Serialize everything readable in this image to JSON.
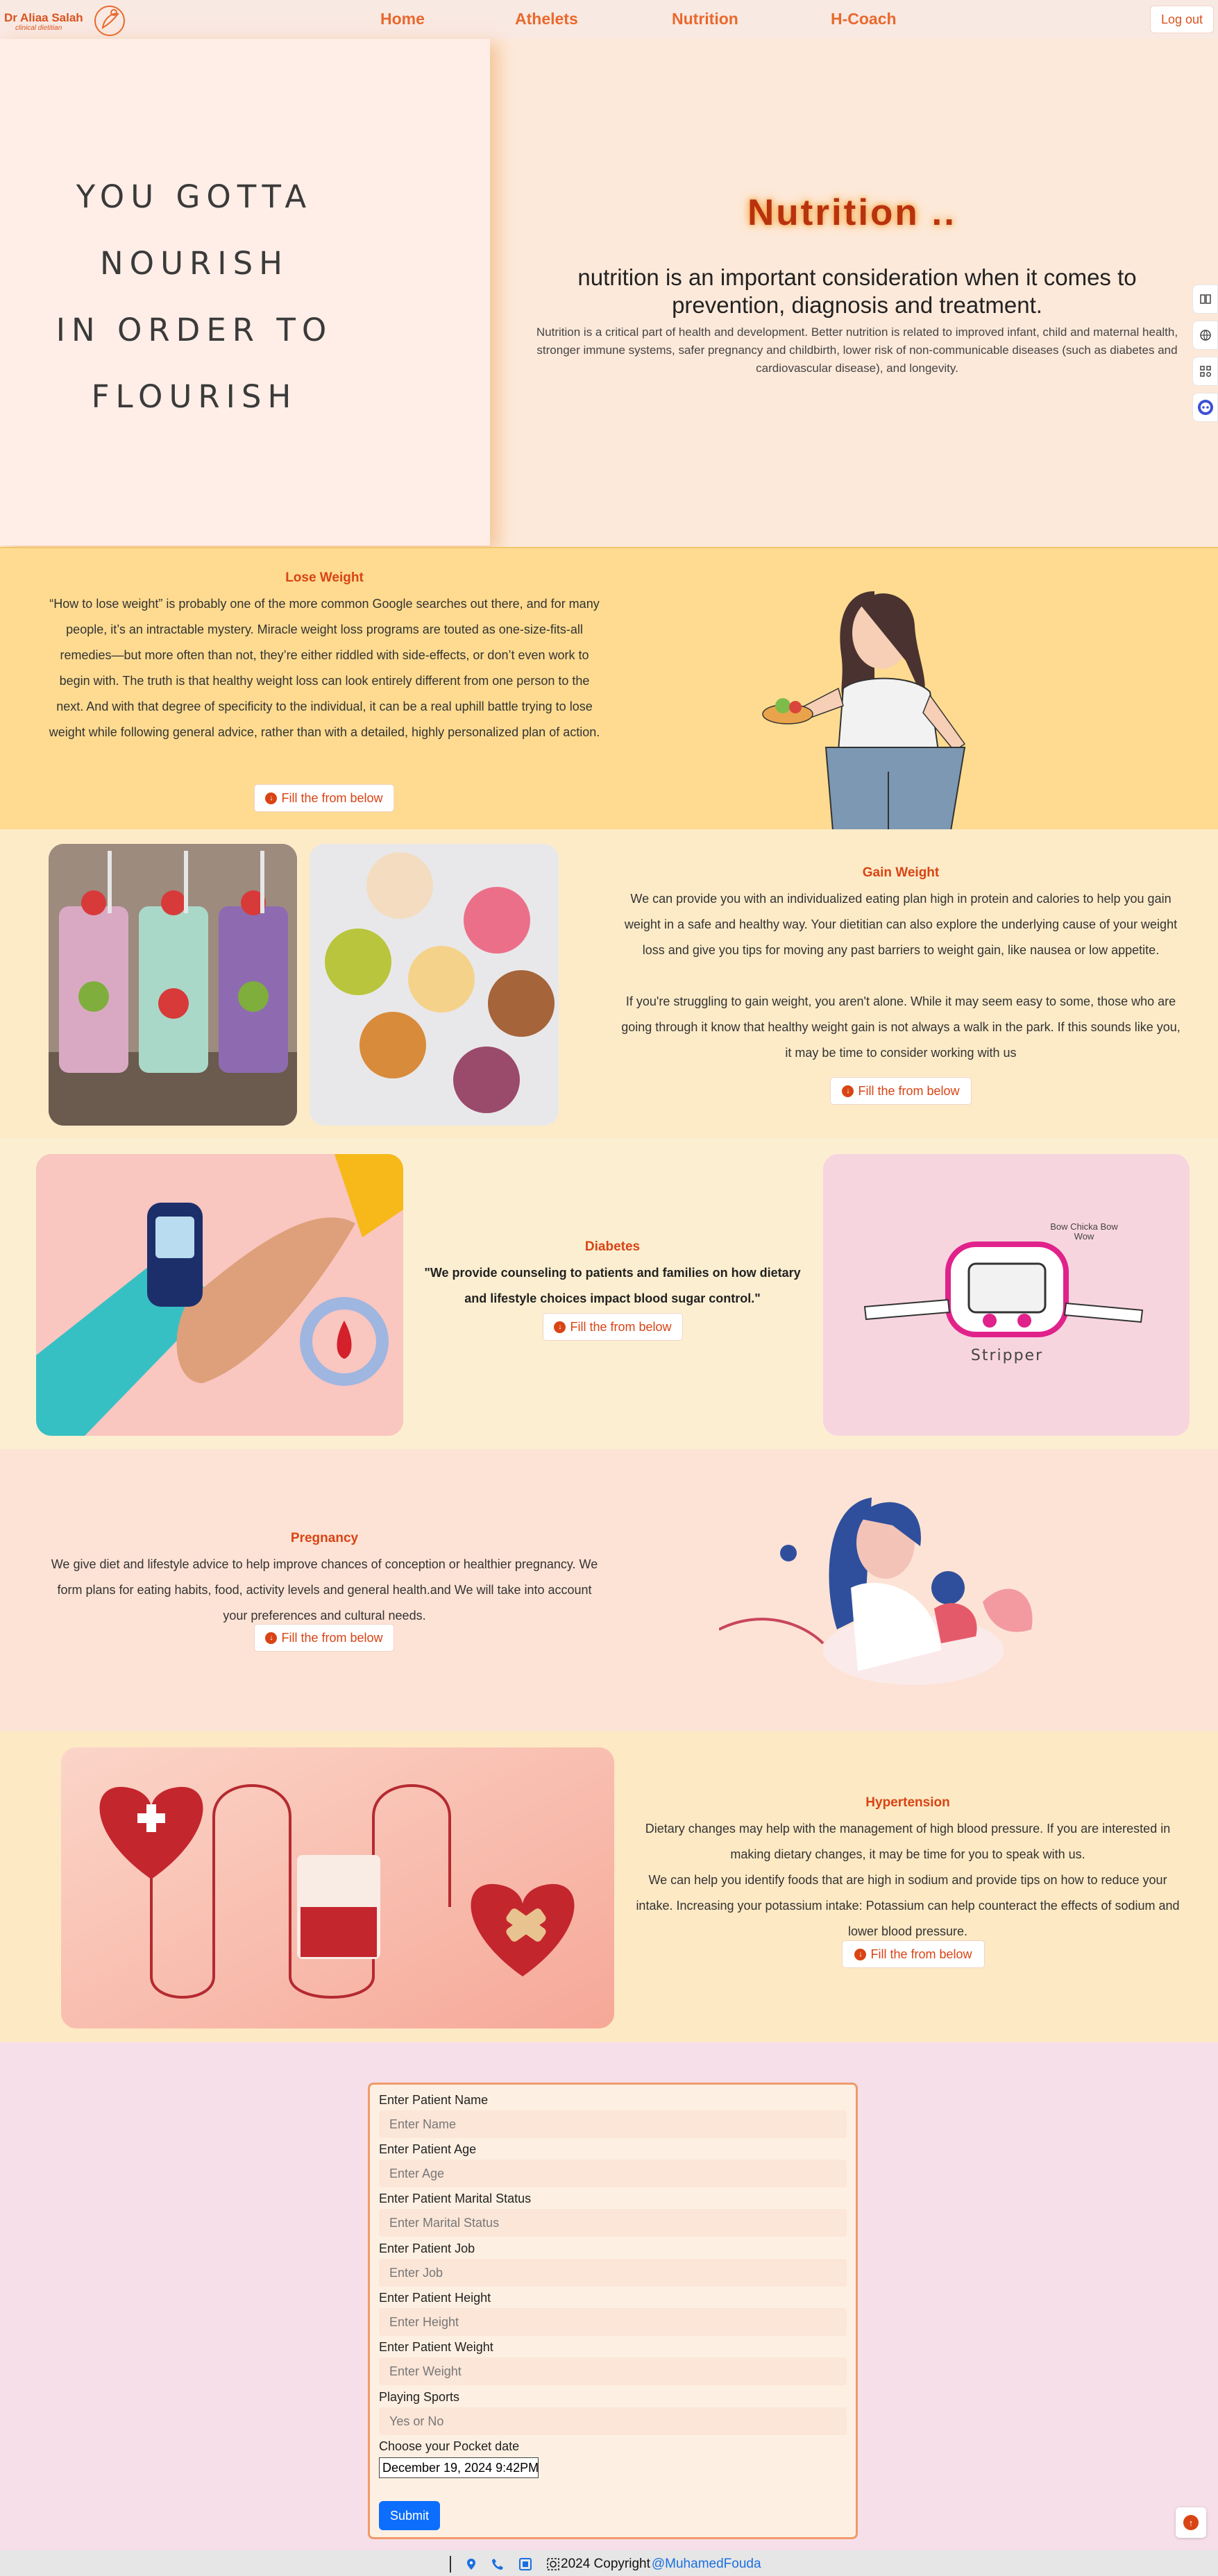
{
  "colors": {
    "accent": "#d94414",
    "nav_bg": "#f9e9e3",
    "hero_bg": "#fde9da",
    "lose_bg": "#fedb90",
    "gain_bg": "#fdebc8",
    "diabetes_bg": "#fcefd1",
    "pregnancy_bg": "#fde3d5",
    "hypertension_bg": "#fde9c4",
    "form_section_bg": "#f6dfe9",
    "submit_blue": "#0d6efd"
  },
  "nav": {
    "logo_name": "Dr Aliaa Salah",
    "logo_sub": "clinical dietitian",
    "links": [
      "Home",
      "Athelets",
      "Nutrition",
      "H-Coach"
    ],
    "logout": "Log out"
  },
  "hero": {
    "quote": [
      "YOU GOTTA",
      "NOURISH",
      "IN ORDER TO",
      "FLOURISH"
    ],
    "title": "Nutrition ..",
    "lead": "nutrition is an important consideration when it comes to prevention, diagnosis and treatment.",
    "text": "Nutrition is a critical part of health and development. Better nutrition is related to improved infant, child and maternal health, stronger immune systems, safer pregnancy and childbirth, lower risk of non-communicable diseases (such as diabetes and cardiovascular disease), and longevity."
  },
  "side_icons": [
    "book-icon",
    "globe-icon",
    "apps-icon",
    "assistant-icon"
  ],
  "fill_label": "Fill the from below",
  "lose": {
    "title": "Lose Weight",
    "text": "“How to lose weight” is probably one of the more common Google searches out there, and for many people, it’s an intractable mystery. Miracle weight loss programs are touted as one-size-fits-all remedies—but more often than not, they’re either riddled with side-effects, or don’t even work to begin with. The truth is that healthy weight loss can look entirely different from one person to the next. And with that degree of specificity to the individual, it can be a real uphill battle trying to lose weight while following general advice, rather than with a detailed, highly personalized plan of action."
  },
  "gain": {
    "title": "Gain Weight",
    "text1": "We can provide you with an individualized eating plan high in protein and calories to help you gain weight in a safe and healthy way. Your dietitian can also explore the underlying cause of your weight loss and give you tips for moving any past barriers to weight gain, like nausea or low appetite.",
    "text2": "If you're struggling to gain weight, you aren't alone. While it may seem easy to some, those who are going through it know that healthy weight gain is not always a walk in the park. If this sounds like you, it may be time to consider working with us"
  },
  "diabetes": {
    "title": "Diabetes",
    "text": "\"We provide counseling to patients and families on how dietary and lifestyle choices impact blood sugar control.\"",
    "graphic_caption": "Stripper",
    "graphic_note": "Bow Chicka Bow Wow"
  },
  "pregnancy": {
    "title": "Pregnancy",
    "text": "We give diet and lifestyle advice to help improve chances of conception or healthier pregnancy. We form plans for eating habits, food, activity levels and general health.and We will take into account your preferences and cultural needs."
  },
  "hypertension": {
    "title": "Hypertension",
    "text1": "Dietary changes may help with the management of high blood pressure. If you are interested in making dietary changes, it may be time for you to speak with us.",
    "text2": "We can help you identify foods that are high in sodium and provide tips on how to reduce your intake. Increasing your potassium intake: Potassium can help counteract the effects of sodium and lower blood pressure."
  },
  "form": {
    "fields": [
      {
        "label": "Enter Patient Name",
        "placeholder": "Enter Name"
      },
      {
        "label": "Enter Patient Age",
        "placeholder": "Enter Age"
      },
      {
        "label": "Enter Patient Marital Status",
        "placeholder": "Enter Marital Status"
      },
      {
        "label": "Enter Patient Job",
        "placeholder": "Enter Job"
      },
      {
        "label": "Enter Patient Height",
        "placeholder": "Enter Height"
      },
      {
        "label": "Enter Patient Weight",
        "placeholder": "Enter Weight"
      },
      {
        "label": "Playing Sports",
        "placeholder": "Yes or No"
      }
    ],
    "date_label": "Choose your Pocket date",
    "date_value": "December 19, 2024 9:42PM",
    "submit": "Submit"
  },
  "footer": {
    "copyright": "2024 Copyright",
    "author": "@MuhamedFouda"
  }
}
